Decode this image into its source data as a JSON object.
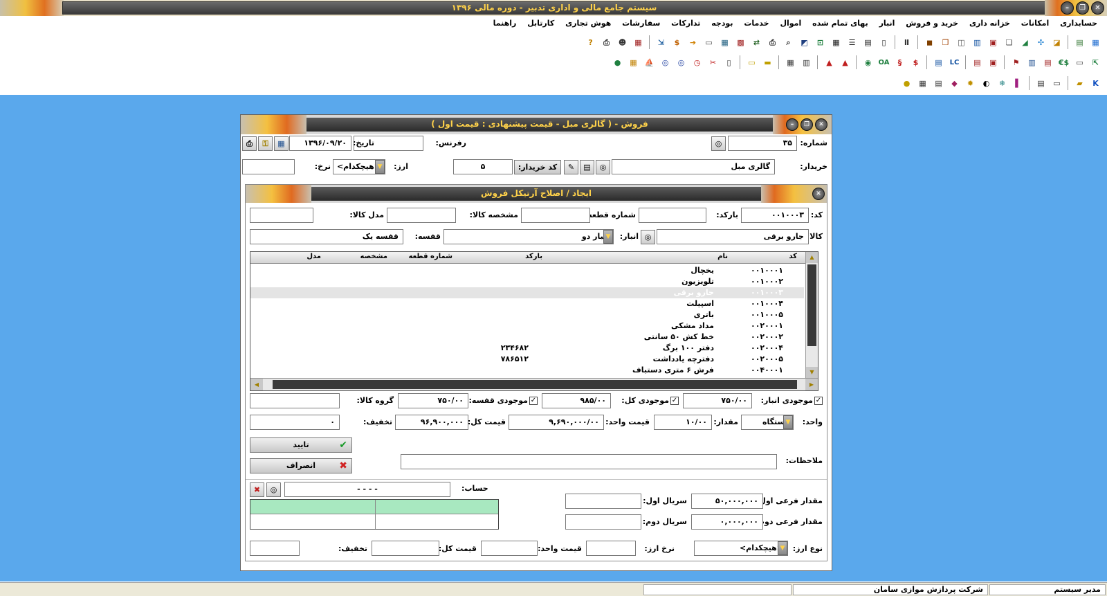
{
  "app": {
    "title": "سیستم جامع مالی و اداری تدبیر - دوره مالی ۱۳۹۶"
  },
  "menu": [
    "حسابداری",
    "امکانات",
    "خزانه داری",
    "خرید و فروش",
    "انبار",
    "بهای تمام شده",
    "اموال",
    "خدمات",
    "بودجه",
    "تدارکات",
    "سفارشات",
    "هوش تجاری",
    "کارتابل",
    "راهنما"
  ],
  "toolbar_row3_text": {
    "oa": "OA",
    "lc": "LC"
  },
  "main_window": {
    "title": "فروش - ( گالری مبل - قیمت پیشنهادی : قیمت اول )",
    "number_label": "شماره:",
    "number_value": "۳۵",
    "reference_label": "رفرنس:",
    "reference_value": "",
    "date_label": "تاریخ:",
    "date_value": "۱۳۹۶/۰۹/۲۰",
    "buyer_label": "خریدار:",
    "buyer_value": "گالری مبل",
    "buyer_code_button": "کد خریدار:",
    "buyer_code_value": "۵",
    "currency_label": "ارز:",
    "currency_value": "<هیچکدام>",
    "rate_label": "نرخ:",
    "rate_value": ""
  },
  "dialog": {
    "title": "ایجاد / اصلاح آرتیکل فروش",
    "code_label": "کد:",
    "code_value": "۰۰۱۰۰۰۳",
    "barcode_label": "بارکد:",
    "barcode_value": "",
    "part_number_label": "شماره قطعه:",
    "part_number_value": "",
    "spec_label": "مشخصه کالا:",
    "spec_value": "",
    "model_label": "مدل کالا:",
    "model_value": "",
    "item_label": "کالا:",
    "item_value": "جارو برقی",
    "warehouse_label": "انبار:",
    "warehouse_value": "انبار دو",
    "shelf_label": "قفسه:",
    "shelf_value": "قفسه یک",
    "grid": {
      "headers": {
        "code": "کد",
        "name": "نام",
        "barcode": "بارکد",
        "part_number": "شماره قطعه",
        "spec": "مشخصه",
        "model": "مدل"
      },
      "rows": [
        {
          "code": "۰۰۱۰۰۰۱",
          "name": "یخچال",
          "barcode": ""
        },
        {
          "code": "۰۰۱۰۰۰۲",
          "name": "تلویزیون",
          "barcode": ""
        },
        {
          "code": "۰۰۱۰۰۰۳",
          "name": "جارو برقی",
          "barcode": ""
        },
        {
          "code": "۰۰۱۰۰۰۴",
          "name": "اسپیلت",
          "barcode": ""
        },
        {
          "code": "۰۰۱۰۰۰۵",
          "name": "باتری",
          "barcode": ""
        },
        {
          "code": "۰۰۲۰۰۰۱",
          "name": "مداد مشکی",
          "barcode": ""
        },
        {
          "code": "۰۰۲۰۰۰۲",
          "name": "خط کش ۵۰ سانتی",
          "barcode": ""
        },
        {
          "code": "۰۰۲۰۰۰۴",
          "name": "دفتر ۱۰۰ برگ",
          "barcode": "۲۳۴۶۸۲"
        },
        {
          "code": "۰۰۲۰۰۰۵",
          "name": "دفترچه یادداشت",
          "barcode": "۷۸۶۵۱۲"
        },
        {
          "code": "۰۰۴۰۰۰۱",
          "name": "فرش ۶ متری دستباف",
          "barcode": ""
        }
      ],
      "selected_index": 2
    },
    "stock_wh_label": "موجودی انبار:",
    "stock_wh_value": "۷۵۰/۰۰",
    "stock_total_label": "موجودی کل:",
    "stock_total_value": "۹۸۵/۰۰",
    "stock_shelf_label": "موجودی قفسه:",
    "stock_shelf_value": "۷۵۰/۰۰",
    "group_label": "گروه کالا:",
    "group_value": "",
    "unit_label": "واحد:",
    "unit_value": "دستگاه",
    "qty_label": "مقدار:",
    "qty_value": "۱۰/۰۰",
    "unit_price_label": "قیمت واحد:",
    "unit_price_value": "۹,۶۹۰,۰۰۰/۰۰",
    "total_price_label": "قیمت کل:",
    "total_price_value": "۹۶,۹۰۰,۰۰۰",
    "discount_label": "تخفیف:",
    "discount_value": "۰",
    "confirm_button": "تایید",
    "cancel_button": "انصراف",
    "notes_label": "ملاحظات:",
    "notes_value": "",
    "account_label": "حساب:",
    "account_value": "- - - -",
    "sub_qty1_label": "مقدار فرعی اول:",
    "sub_qty1_value": "۵۰,۰۰۰,۰۰۰",
    "serial1_label": "سریال اول:",
    "serial1_value": "",
    "sub_qty2_label": "مقدار فرعی دوم:",
    "sub_qty2_value": "۰,۰۰۰,۰۰۰",
    "serial2_label": "سریال دوم:",
    "serial2_value": "",
    "currency_type_label": "نوع ارز:",
    "currency_type_value": "<هیچکدام>",
    "fx_rate_label": "نرخ ارز:",
    "fx_rate_value": "",
    "fx_unit_price_label": "قیمت واحد:",
    "fx_unit_price_value": "",
    "fx_total_label": "قیمت کل:",
    "fx_total_value": "",
    "fx_discount_label": "تخفیف:",
    "fx_discount_value": ""
  },
  "status": {
    "user": "مدیر سیستم",
    "company": "شرکت پردازش موازی سامان",
    "cell3": "",
    "cell4": ""
  },
  "colors": {
    "desktop": "#5aa8ec",
    "title_text": "#ffd24a",
    "selected_row": "#e4e4e4",
    "account_grid_header": "#a8e8c0"
  }
}
